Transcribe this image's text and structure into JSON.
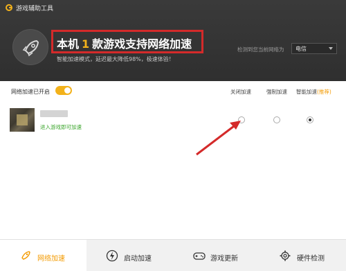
{
  "app": {
    "title": "游戏辅助工具"
  },
  "header": {
    "headline_prefix": "本机",
    "headline_count": "1",
    "headline_suffix": "款游戏支持网络加速",
    "subline": "智能加速模式，延迟最大降低98%，极速体验！",
    "network_label": "检测到您当前网络为",
    "network_value": "电信"
  },
  "toolbar": {
    "toggle_label": "网络加速已开启",
    "toggle_on": true,
    "columns": {
      "close": "关闭加速",
      "force": "强制加速",
      "smart": "智能加速",
      "smart_rec": "(推荐)"
    }
  },
  "games": [
    {
      "hint": "进入游戏即可加速",
      "mode": "smart"
    }
  ],
  "bottom_nav": [
    {
      "label": "网络加速",
      "icon": "rocket-icon",
      "active": true
    },
    {
      "label": "启动加速",
      "icon": "lightning-icon",
      "active": false
    },
    {
      "label": "游戏更新",
      "icon": "gamepad-icon",
      "active": false
    },
    {
      "label": "硬件检测",
      "icon": "gear-icon",
      "active": false
    }
  ],
  "colors": {
    "accent": "#f3b21b",
    "annotation_red": "#d42a2a",
    "hint_green": "#3aa52b"
  }
}
